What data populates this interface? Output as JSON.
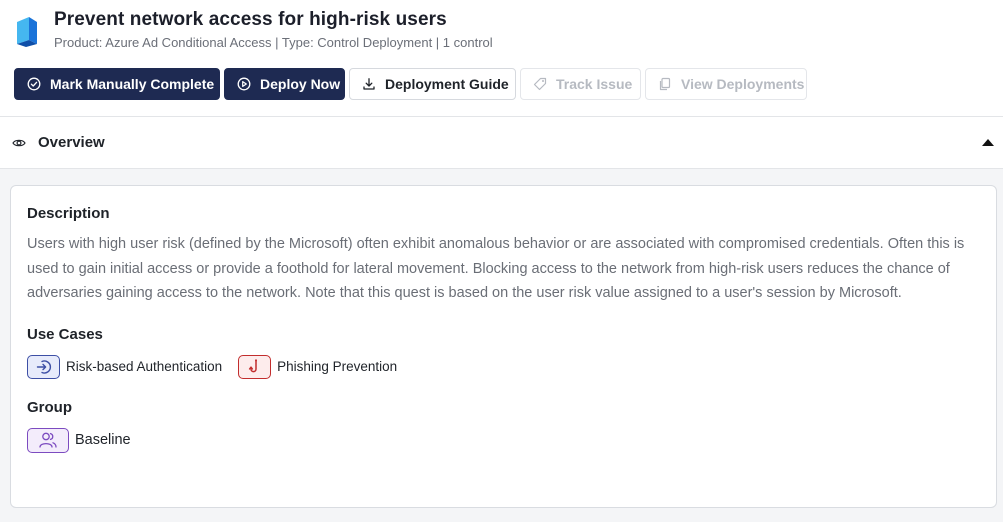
{
  "header": {
    "title": "Prevent network access for high-risk users",
    "subtitle": "Product: Azure Ad Conditional Access | Type: Control Deployment | 1 control"
  },
  "toolbar": {
    "mark_complete": "Mark Manually Complete",
    "deploy_now": "Deploy Now",
    "deployment_guide": "Deployment Guide",
    "track_issue": "Track Issue",
    "view_deployments": "View Deployments"
  },
  "overview": {
    "label": "Overview"
  },
  "description": {
    "heading": "Description",
    "text": "Users with high user risk (defined by the Microsoft) often exhibit anomalous behavior or are associated with compromised credentials. Often this is used to gain initial access or provide a foothold for lateral movement. Blocking access to the network from high-risk users reduces the chance of adversaries gaining access to the network. Note that this quest is based on the user risk value assigned to a user's session by Microsoft."
  },
  "use_cases": {
    "heading": "Use Cases",
    "items": [
      {
        "label": "Risk-based Authentication",
        "icon": "sign-in-icon",
        "color": "#3d4fa5"
      },
      {
        "label": "Phishing Prevention",
        "icon": "fishhook-icon",
        "color": "#c22d2d"
      }
    ]
  },
  "group": {
    "heading": "Group",
    "label": "Baseline",
    "icon": "users-icon",
    "color": "#7c4bc0"
  },
  "colors": {
    "primary_button": "#1e2a52",
    "logo_blue": "#1a73d9"
  }
}
